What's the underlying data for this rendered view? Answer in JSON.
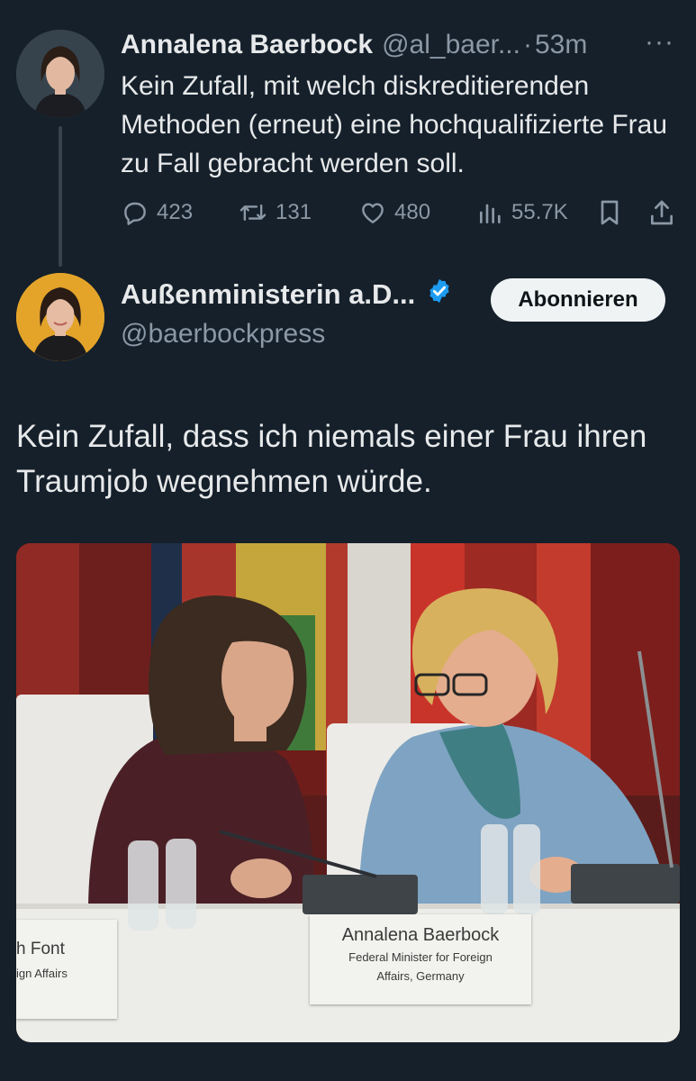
{
  "parent_tweet": {
    "author_name": "Annalena Baerbock",
    "handle": "@al_baer...",
    "separator": "·",
    "time": "53m",
    "more": "···",
    "text": "Kein Zufall, mit welch diskreditierenden Methoden (erneut) eine hochqualifizierte Frau zu Fall gebracht werden soll.",
    "stats": {
      "replies": "423",
      "reposts": "131",
      "likes": "480",
      "views": "55.7K"
    }
  },
  "quoted_tweet": {
    "author_name": "Außenministerin a.D...",
    "handle": "@baerbockpress",
    "verified": true,
    "follow_label": "Abonnieren",
    "text": "Kein Zufall, dass ich niemals einer Frau ihren Traumjob wegnehmen würde."
  },
  "photo": {
    "placard_name": "Annalena Baerbock",
    "placard_title_line1": "Federal Minister for Foreign",
    "placard_title_line2": "Affairs, Germany",
    "left_placard_name": "h Font",
    "left_placard_title": "ign Affairs"
  },
  "colors": {
    "background": "#15202b",
    "text_primary": "#e7e9ea",
    "text_secondary": "#8b98a5",
    "verified_blue": "#1d9bf0",
    "follow_button_bg": "#eff3f4"
  },
  "icons": [
    "reply-icon",
    "repost-icon",
    "like-icon",
    "views-icon",
    "bookmark-icon",
    "share-icon",
    "verified-badge-icon",
    "more-icon"
  ]
}
